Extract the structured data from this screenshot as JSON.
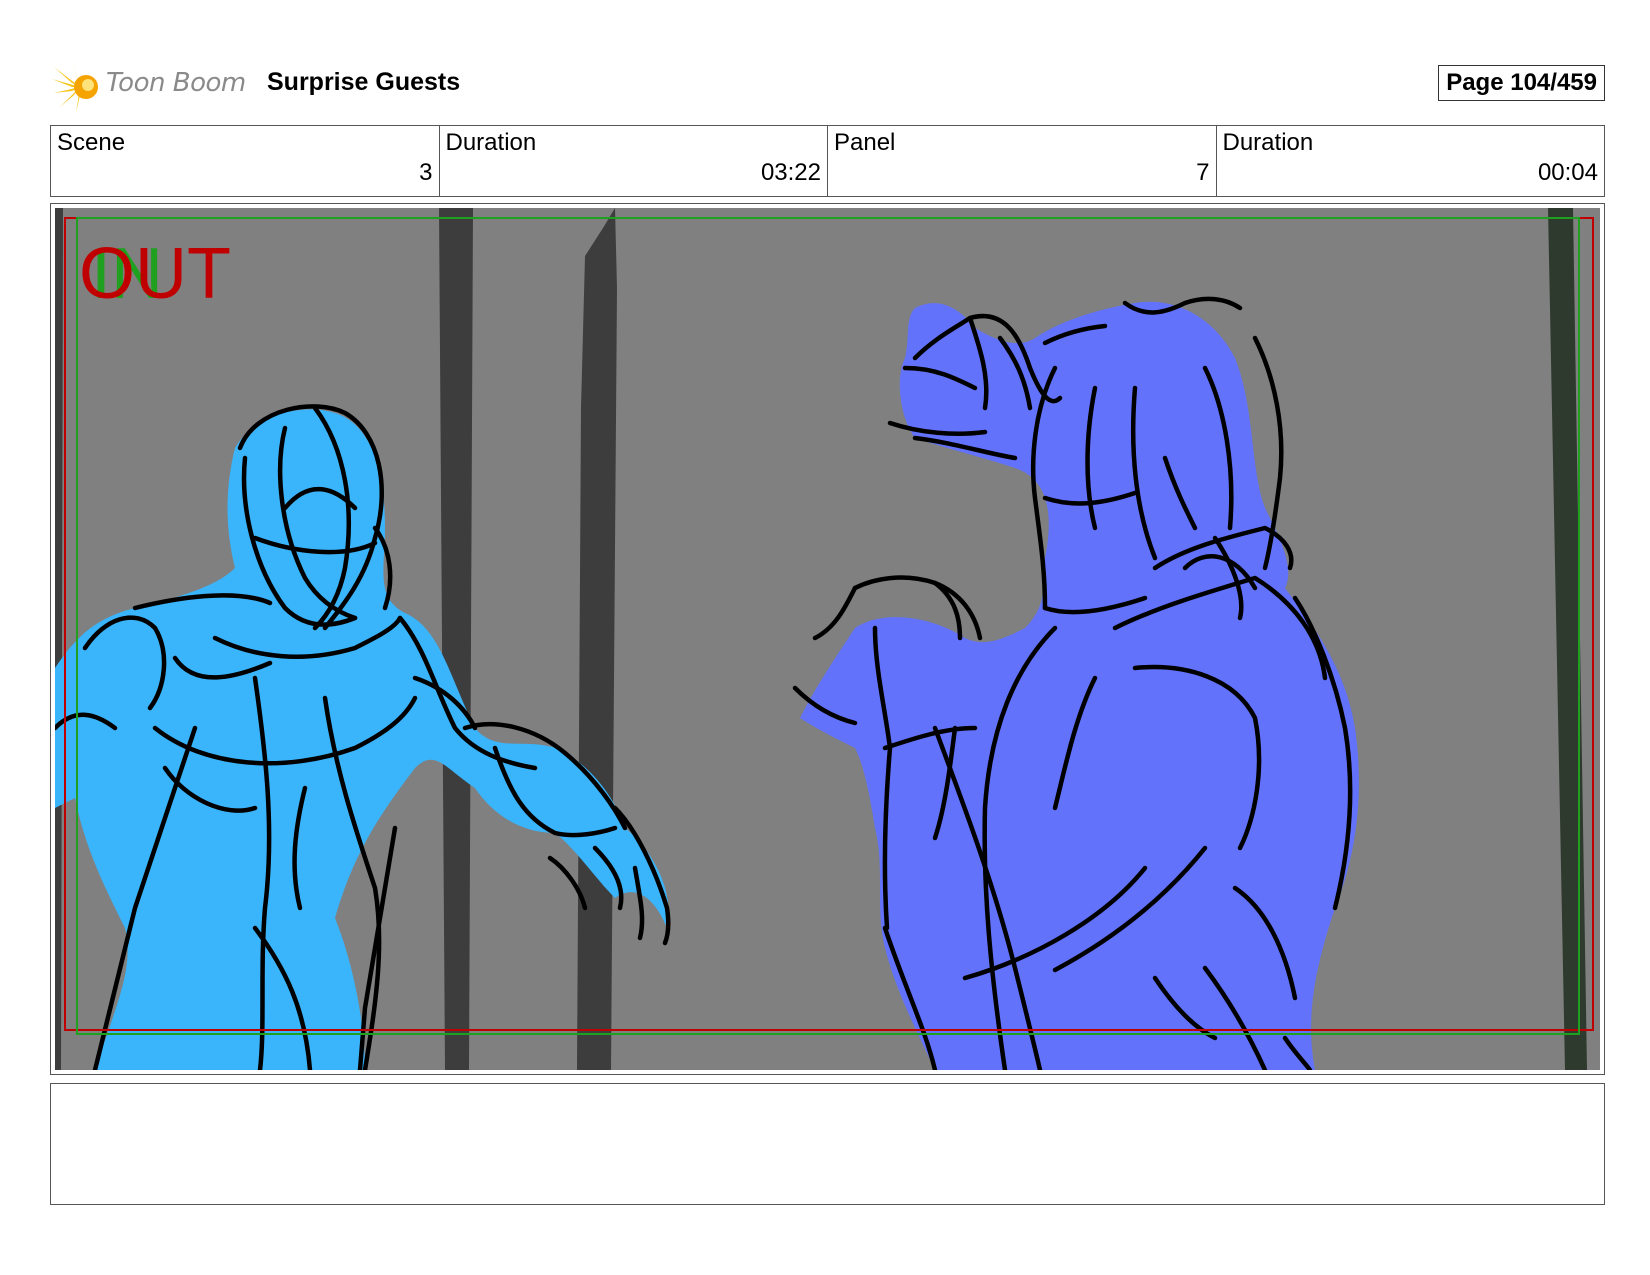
{
  "header": {
    "logo_text": "Toon Boom",
    "project_title": "Surprise Guests",
    "page_label": "Page 104/459"
  },
  "info": [
    {
      "label": "Scene",
      "value": "3"
    },
    {
      "label": "Duration",
      "value": "03:22"
    },
    {
      "label": "Panel",
      "value": "7"
    },
    {
      "label": "Duration",
      "value": "00:04"
    }
  ],
  "panel": {
    "marker_out": "OUT",
    "marker_in": "IN",
    "colors": {
      "background": "#808080",
      "tree": "#3d3d3d",
      "left_figure": "#3ab4fb",
      "right_figure": "#6272fb",
      "out_marker": "#c00000",
      "in_marker": "#1fa01f"
    }
  },
  "notes": {
    "text": ""
  }
}
